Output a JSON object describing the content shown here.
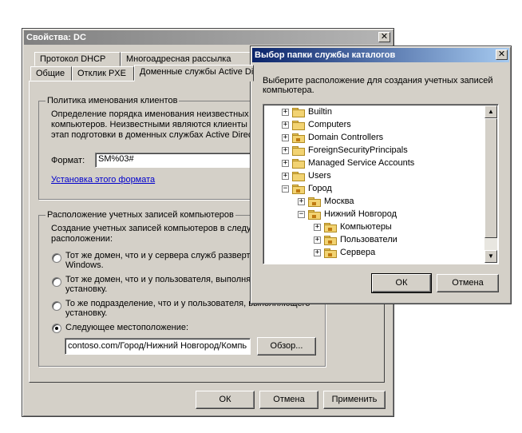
{
  "props_dialog": {
    "title": "Свойства: DC",
    "tabs_back": [
      "Протокол DHCP",
      "Многоадресная рассылка"
    ],
    "tabs_front": [
      "Общие",
      "Отклик PXE",
      "Доменные службы Active Directory"
    ],
    "naming_group": {
      "legend": "Политика именования клиентов",
      "desc_lines": [
        "Определение порядка именования неизвестных",
        "компьютеров. Неизвестными являются клиенты",
        "этап подготовки в доменных службах Active Direct"
      ],
      "format_label": "Формат:",
      "format_value": "SM%03#",
      "setup_link": "Установка этого формата"
    },
    "location_group": {
      "legend": "Расположение учетных записей компьютеров",
      "desc_lines": [
        "Создание учетных записей компьютеров в следу",
        "расположении:"
      ],
      "options": [
        {
          "line1": "Тот же домен, что и у сервера служб разверт",
          "line2": "Windows.",
          "selected": false
        },
        {
          "line1": "Тот же домен, что и у пользователя, выполня",
          "line2": "установку.",
          "selected": false
        },
        {
          "line1": "То же подразделение, что и у пользователя, выполняющего",
          "line2": "установку.",
          "selected": false
        },
        {
          "line1": "Следующее местоположение:",
          "line2": "",
          "selected": true
        }
      ],
      "path_value": "contoso.com/Город/Нижний Новгород/Компь",
      "browse_label": "Обзор..."
    },
    "buttons": {
      "ok": "ОК",
      "cancel": "Отмена",
      "apply": "Применить"
    }
  },
  "folder_dialog": {
    "title": "Выбор папки службы каталогов",
    "prompt_lines": [
      "Выберите расположение для создания учетных записей",
      "компьютера."
    ],
    "tree": [
      {
        "label": "Builtin",
        "level": 0,
        "expander": "+",
        "kind": "folder"
      },
      {
        "label": "Computers",
        "level": 0,
        "expander": "+",
        "kind": "folder"
      },
      {
        "label": "Domain Controllers",
        "level": 0,
        "expander": "+",
        "kind": "ou"
      },
      {
        "label": "ForeignSecurityPrincipals",
        "level": 0,
        "expander": "+",
        "kind": "folder"
      },
      {
        "label": "Managed Service Accounts",
        "level": 0,
        "expander": "+",
        "kind": "folder"
      },
      {
        "label": "Users",
        "level": 0,
        "expander": "+",
        "kind": "folder"
      },
      {
        "label": "Город",
        "level": 0,
        "expander": "-",
        "kind": "ou"
      },
      {
        "label": "Москва",
        "level": 1,
        "expander": "+",
        "kind": "ou"
      },
      {
        "label": "Нижний Новгород",
        "level": 1,
        "expander": "-",
        "kind": "ou"
      },
      {
        "label": "Компьютеры",
        "level": 2,
        "expander": "+",
        "kind": "ou"
      },
      {
        "label": "Пользователи",
        "level": 2,
        "expander": "+",
        "kind": "ou"
      },
      {
        "label": "Сервера",
        "level": 2,
        "expander": "+",
        "kind": "ou"
      }
    ],
    "buttons": {
      "ok": "ОК",
      "cancel": "Отмена"
    }
  }
}
